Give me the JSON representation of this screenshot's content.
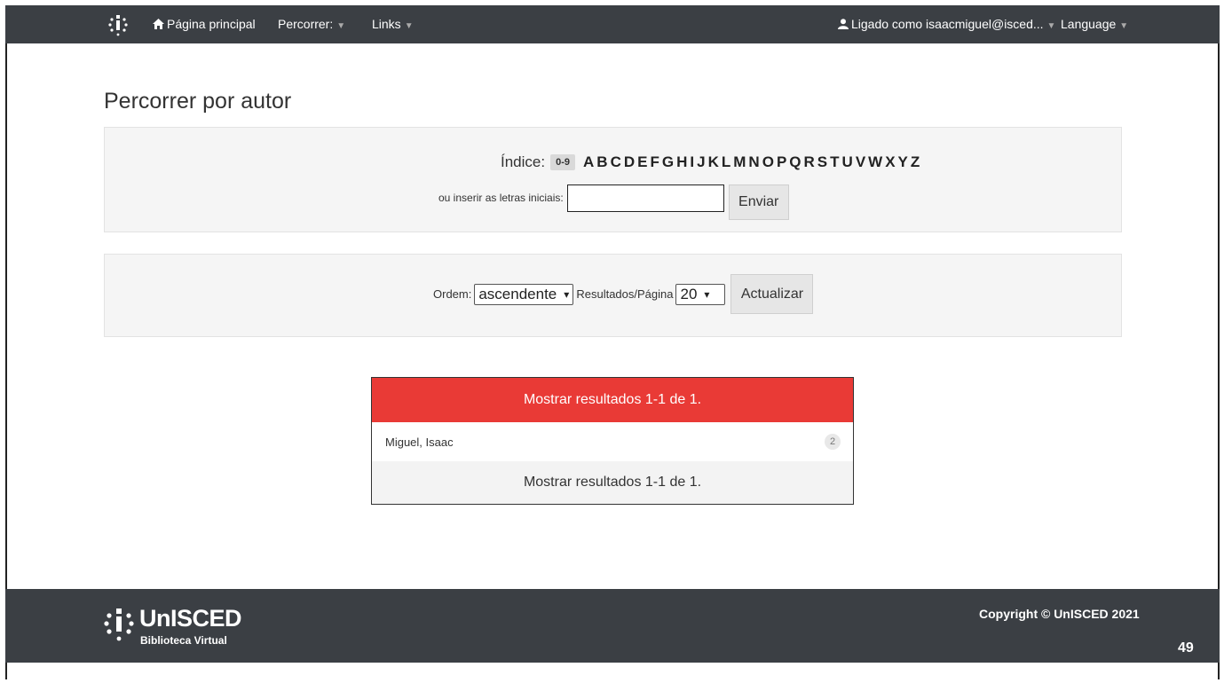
{
  "nav": {
    "home": "Página principal",
    "browse": "Percorrer:",
    "links": "Links",
    "user": "Ligado como isaacmiguel@isced...",
    "language": "Language"
  },
  "page": {
    "title": "Percorrer por autor"
  },
  "index": {
    "label": "Índice:",
    "range": "0-9",
    "letters": [
      "A",
      "B",
      "C",
      "D",
      "E",
      "F",
      "G",
      "H",
      "I",
      "J",
      "K",
      "L",
      "M",
      "N",
      "O",
      "P",
      "Q",
      "R",
      "S",
      "T",
      "U",
      "V",
      "W",
      "X",
      "Y",
      "Z"
    ],
    "prefix_label": "ou inserir as letras iniciais:",
    "prefix_value": "",
    "submit": "Enviar"
  },
  "controls": {
    "order_label": "Ordem:",
    "order_value": "ascendente",
    "rpp_label": "Resultados/Página",
    "rpp_value": "20",
    "update": "Actualizar"
  },
  "results": {
    "header": "Mostrar resultados 1-1 de 1.",
    "items": [
      {
        "name": "Miguel, Isaac",
        "count": "2"
      }
    ],
    "footer": "Mostrar resultados 1-1 de 1."
  },
  "footer": {
    "brand": "UnISCED",
    "subtitle": "Biblioteca Virtual",
    "copyright": "Copyright © UnISCED 2021",
    "slide_number": "49"
  },
  "colors": {
    "navbar": "#3b3f44",
    "accent": "#e93a36",
    "well": "#f5f5f5"
  }
}
